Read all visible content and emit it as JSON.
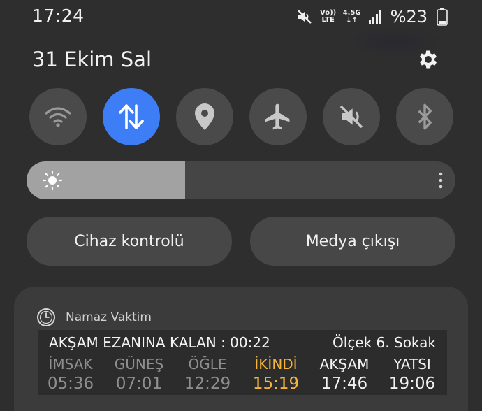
{
  "status_bar": {
    "time": "17:24",
    "volte_top": "Vo))",
    "volte_bottom": "LTE",
    "network_top": "4.5G",
    "network_bottom": "↓↑",
    "battery_percent": "%23",
    "icons": [
      "mute-icon",
      "volte-icon",
      "network-icon",
      "signal-icon",
      "battery-icon"
    ]
  },
  "header": {
    "date": "31 Ekim Sal",
    "settings_icon": "gear-icon"
  },
  "quick_toggles": [
    {
      "icon": "wifi-icon",
      "active": false
    },
    {
      "icon": "mobile-data-icon",
      "active": true
    },
    {
      "icon": "location-icon",
      "active": false
    },
    {
      "icon": "airplane-icon",
      "active": false
    },
    {
      "icon": "mute-icon",
      "active": false
    },
    {
      "icon": "bluetooth-icon",
      "active": false
    }
  ],
  "brightness": {
    "level_percent": 37,
    "icon": "sun-icon"
  },
  "buttons": {
    "device_control": "Cihaz kontrolü",
    "media_output": "Medya çıkışı"
  },
  "notification": {
    "app_name": "Namaz Vaktim",
    "app_icon": "clock-icon",
    "remaining": "AKŞAM EZANINA KALAN : 00:22",
    "location": "Ölçek 6. Sokak",
    "prayers": [
      {
        "name": "İMSAK",
        "time": "05:36"
      },
      {
        "name": "GÜNEŞ",
        "time": "07:01"
      },
      {
        "name": "ÖĞLE",
        "time": "12:29"
      },
      {
        "name": "İKİNDİ",
        "time": "15:19"
      },
      {
        "name": "AKŞAM",
        "time": "17:46"
      },
      {
        "name": "YATSI",
        "time": "19:06"
      }
    ]
  },
  "colors": {
    "accent": "#3d7ef7",
    "current_prayer": "#f4b43e"
  }
}
